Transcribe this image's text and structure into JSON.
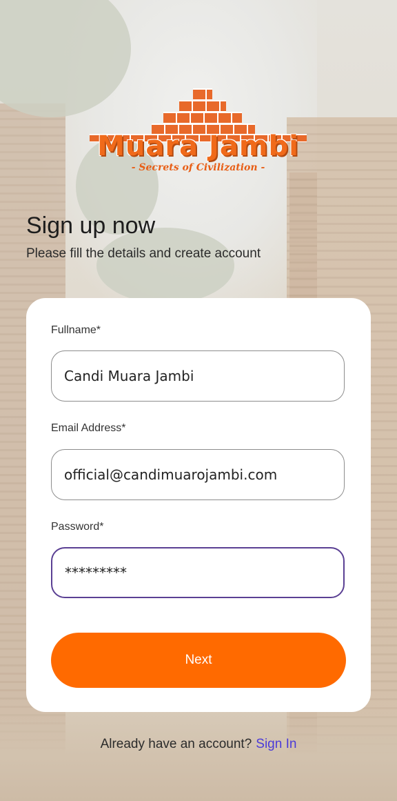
{
  "logo": {
    "title": "Muara Jambi",
    "subtitle": "- Secrets of Civilization -"
  },
  "heading": "Sign up now",
  "subheading": "Please fill the details and create account",
  "form": {
    "fullname": {
      "label": "Fullname*",
      "value": "Candi Muara Jambi"
    },
    "email": {
      "label": "Email Address*",
      "value": "official@candimuarojambi.com"
    },
    "password": {
      "label": "Password*",
      "value": "*********"
    },
    "next_label": "Next"
  },
  "footer": {
    "prompt": "Already have an account?",
    "link": "Sign In"
  },
  "colors": {
    "accent": "#ff6a00",
    "link": "#4b3bd8",
    "focus_border": "#5a3f93"
  }
}
